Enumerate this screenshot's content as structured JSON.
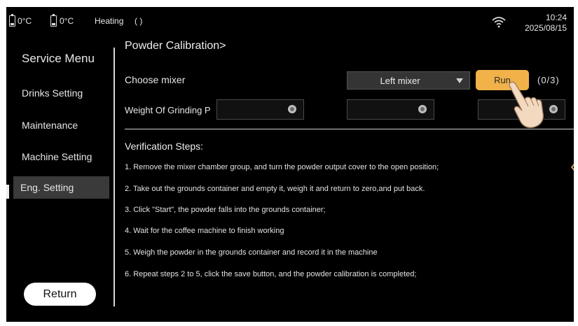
{
  "status_bar": {
    "temp1": "0°C",
    "temp2": "0°C",
    "mode": "Heating",
    "mode_icon": "( )",
    "time": "10:24",
    "date": "2025/08/15",
    "wifi_icon": "wifi-icon"
  },
  "sidebar": {
    "title": "Service Menu",
    "items": [
      {
        "label": "Drinks Setting"
      },
      {
        "label": "Maintenance"
      },
      {
        "label": "Machine Setting"
      },
      {
        "label": "Eng. Setting",
        "active": true
      }
    ],
    "return_label": "Return"
  },
  "main": {
    "title": "Powder Calibration>",
    "choose_mixer_label": "Choose mixer",
    "mixer_value": "Left mixer",
    "run_label": "Run",
    "run_count": "(0/3)",
    "weight_label": "Weight Of Grinding P",
    "weight_fields": [
      "",
      "",
      ""
    ],
    "steps_title": "Verification Steps:",
    "steps": [
      "1. Remove the mixer chamber group, and turn the powder output cover to the open position;",
      "2. Take out the grounds container and empty it, weigh it and return to zero,and put back.",
      "3. Click \"Start\", the powder falls into the grounds container;",
      "4. Wait for the coffee machine to finish working",
      "5. Weigh the powder in the grounds container and record it in the machine",
      "6. Repeat steps 2 to 5, click the save button, and the powder calibration is completed;"
    ]
  },
  "colors": {
    "background": "#000000",
    "accent": "#f1b24a",
    "active_item": "#3a3a3a"
  }
}
